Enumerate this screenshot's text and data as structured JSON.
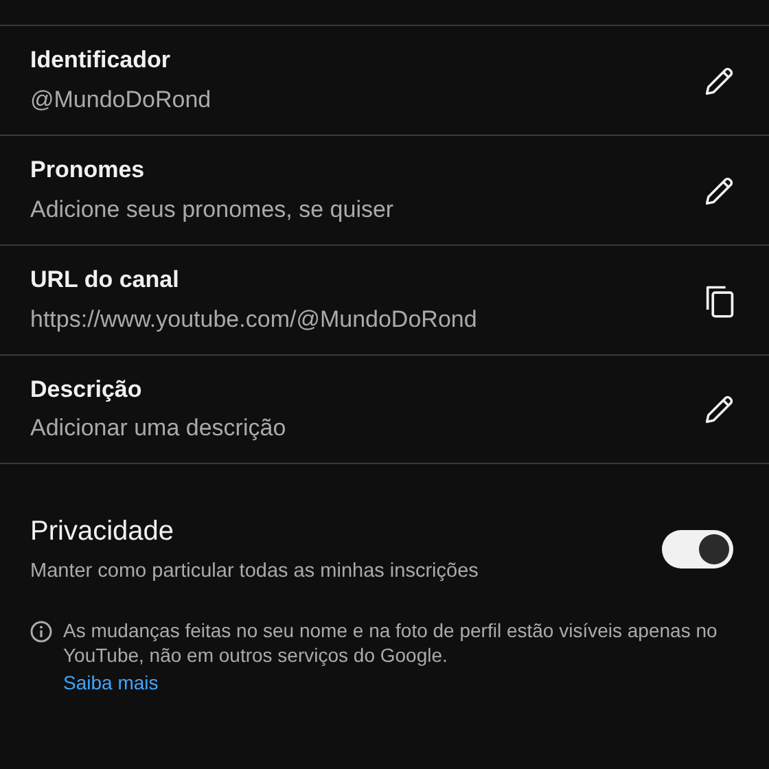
{
  "fields": [
    {
      "label": "Identificador",
      "value": "@MundoDoRond",
      "kind": "edit"
    },
    {
      "label": "Pronomes",
      "value": "Adicione seus pronomes, se quiser",
      "kind": "edit"
    },
    {
      "label": "URL do canal",
      "value": "https://www.youtube.com/@MundoDoRond",
      "kind": "copy"
    },
    {
      "label": "Descrição",
      "value": "Adicionar uma descrição",
      "kind": "edit"
    }
  ],
  "privacy": {
    "title": "Privacidade",
    "description": "Manter como particular todas as minhas inscrições",
    "on": true
  },
  "note": {
    "text": "As mudanças feitas no seu nome e na foto de perfil estão visíveis apenas no YouTube, não em outros serviços do Google.",
    "link": "Saiba mais"
  }
}
